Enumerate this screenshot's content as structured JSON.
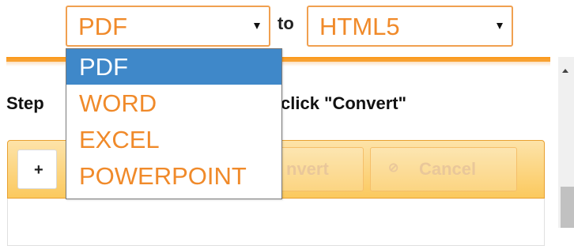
{
  "source_format": {
    "selected": "PDF",
    "options": [
      "PDF",
      "WORD",
      "EXCEL",
      "POWERPOINT"
    ],
    "highlighted_index": 0
  },
  "to_label": "to",
  "target_format": {
    "selected": "HTML5"
  },
  "step": {
    "prefix": "Step",
    "suffix": "click \"Convert\""
  },
  "toolbar": {
    "add_label": "+",
    "convert_label": "nvert",
    "cancel_icon": "⊘",
    "cancel_label": "Cancel"
  },
  "colors": {
    "accent": "#f08a2a",
    "selection": "#3f88c9",
    "toolbar_light": "#fde3a9",
    "toolbar_dark": "#fbc95e"
  }
}
